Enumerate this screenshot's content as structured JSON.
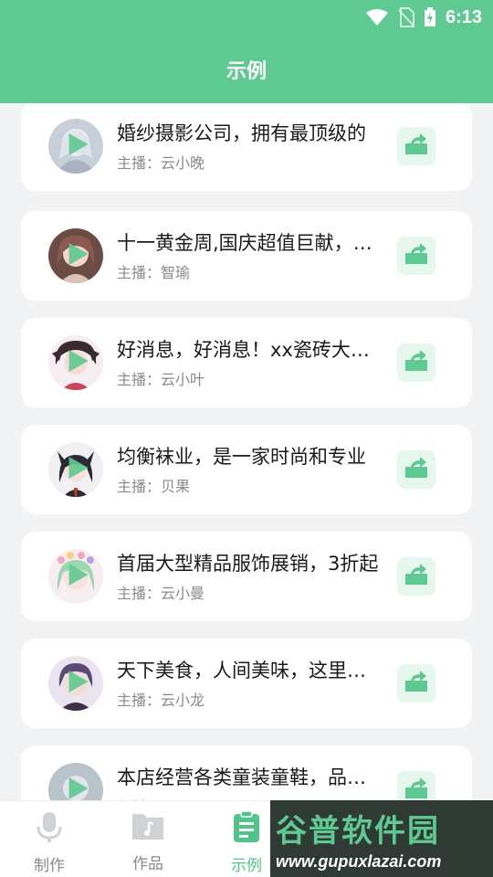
{
  "status_bar": {
    "time": "6:13"
  },
  "header": {
    "title": "示例"
  },
  "host_prefix": "主播：",
  "examples": [
    {
      "title": "婚纱摄影公司，拥有最顶级的",
      "host": "云小晚",
      "avatar_color": "#c9cfd8"
    },
    {
      "title": "十一黄金周,国庆超值巨献，全场",
      "host": "智瑜",
      "avatar_color": "#6b4b43"
    },
    {
      "title": "好消息，好消息！xx瓷砖大促销",
      "host": "云小叶",
      "avatar_color": "#3a2b2e"
    },
    {
      "title": "均衡袜业，是一家时尚和专业",
      "host": "贝果",
      "avatar_color": "#2b2b33"
    },
    {
      "title": "首届大型精品服饰展销，3折起",
      "host": "云小曼",
      "avatar_color": "#9fd6b2"
    },
    {
      "title": "天下美食，人间美味，这里应有",
      "host": "云小龙",
      "avatar_color": "#5a4a78"
    },
    {
      "title": "本店经营各类童装童鞋，品种齐全",
      "host": "",
      "avatar_color": "#b9c3ca"
    }
  ],
  "tabs": [
    {
      "label": "制作",
      "icon": "microphone-icon"
    },
    {
      "label": "作品",
      "icon": "music-folder-icon"
    },
    {
      "label": "示例",
      "icon": "clipboard-icon"
    }
  ],
  "watermark": {
    "text": "谷普软件园",
    "url": "www.gupuxlazai.com"
  },
  "colors": {
    "brand": "#5ec990",
    "share_bg": "#e6f7ed",
    "tab_active": "#52c48a"
  }
}
